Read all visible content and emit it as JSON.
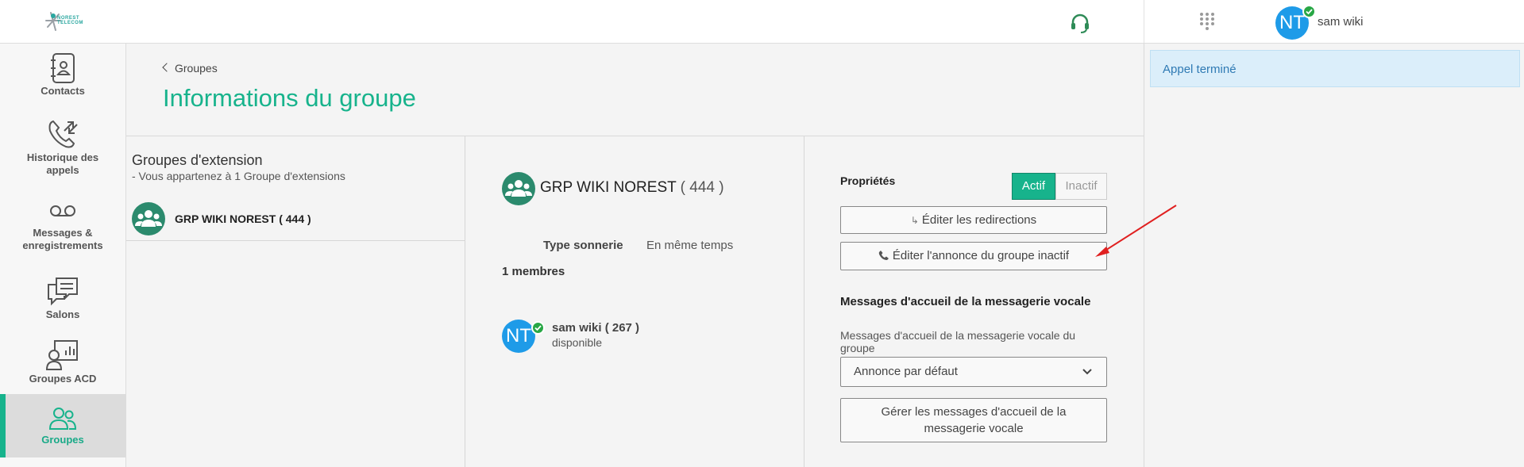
{
  "topbar": {
    "logo_text": "NOREST TELECOM",
    "user_initials": "NT",
    "user_name": "sam wiki"
  },
  "sidebar": {
    "items": [
      {
        "label": "Contacts",
        "icon": "contacts-book-icon"
      },
      {
        "label": "Historique des appels",
        "icon": "call-history-icon"
      },
      {
        "label": "Messages & enregistrements",
        "icon": "voicemail-icon"
      },
      {
        "label": "Salons",
        "icon": "chat-rooms-icon"
      },
      {
        "label": "Groupes ACD",
        "icon": "acd-groups-icon"
      },
      {
        "label": "Groupes",
        "icon": "groups-icon",
        "active": true
      }
    ]
  },
  "header": {
    "breadcrumb": "Groupes",
    "title": "Informations du groupe"
  },
  "extension_groups": {
    "title": "Groupes d'extension",
    "subtitle": "- Vous appartenez à 1 Groupe d'extensions",
    "items": [
      {
        "name": "GRP WIKI NOREST ( 444 )"
      }
    ]
  },
  "group": {
    "name": "GRP WIKI NOREST",
    "number": "( 444 )",
    "ring_type_label": "Type sonnerie",
    "ring_type_value": "En même temps",
    "members_label": "1 membres",
    "members": [
      {
        "initials": "NT",
        "name": "sam wiki ( 267 )",
        "status": "disponible"
      }
    ]
  },
  "properties": {
    "label": "Propriétés",
    "active_label": "Actif",
    "inactive_label": "Inactif",
    "selected": "Actif",
    "edit_redirections": "Éditer les redirections",
    "edit_announcement": "Éditer l'annonce du groupe inactif"
  },
  "voicemail": {
    "title": "Messages d'accueil de la messagerie vocale",
    "field_label": "Messages d'accueil de la messagerie vocale du groupe",
    "selected_value": "Annonce par défaut",
    "manage_button": "Gérer les messages d'accueil de la messagerie vocale"
  },
  "notification": {
    "text": "Appel terminé"
  },
  "colors": {
    "accent": "#17b38c",
    "avatar": "#1e9be8",
    "status_ok": "#28a745",
    "group_icon_bg": "#2b8a6d",
    "annotation_arrow": "#e02020"
  }
}
